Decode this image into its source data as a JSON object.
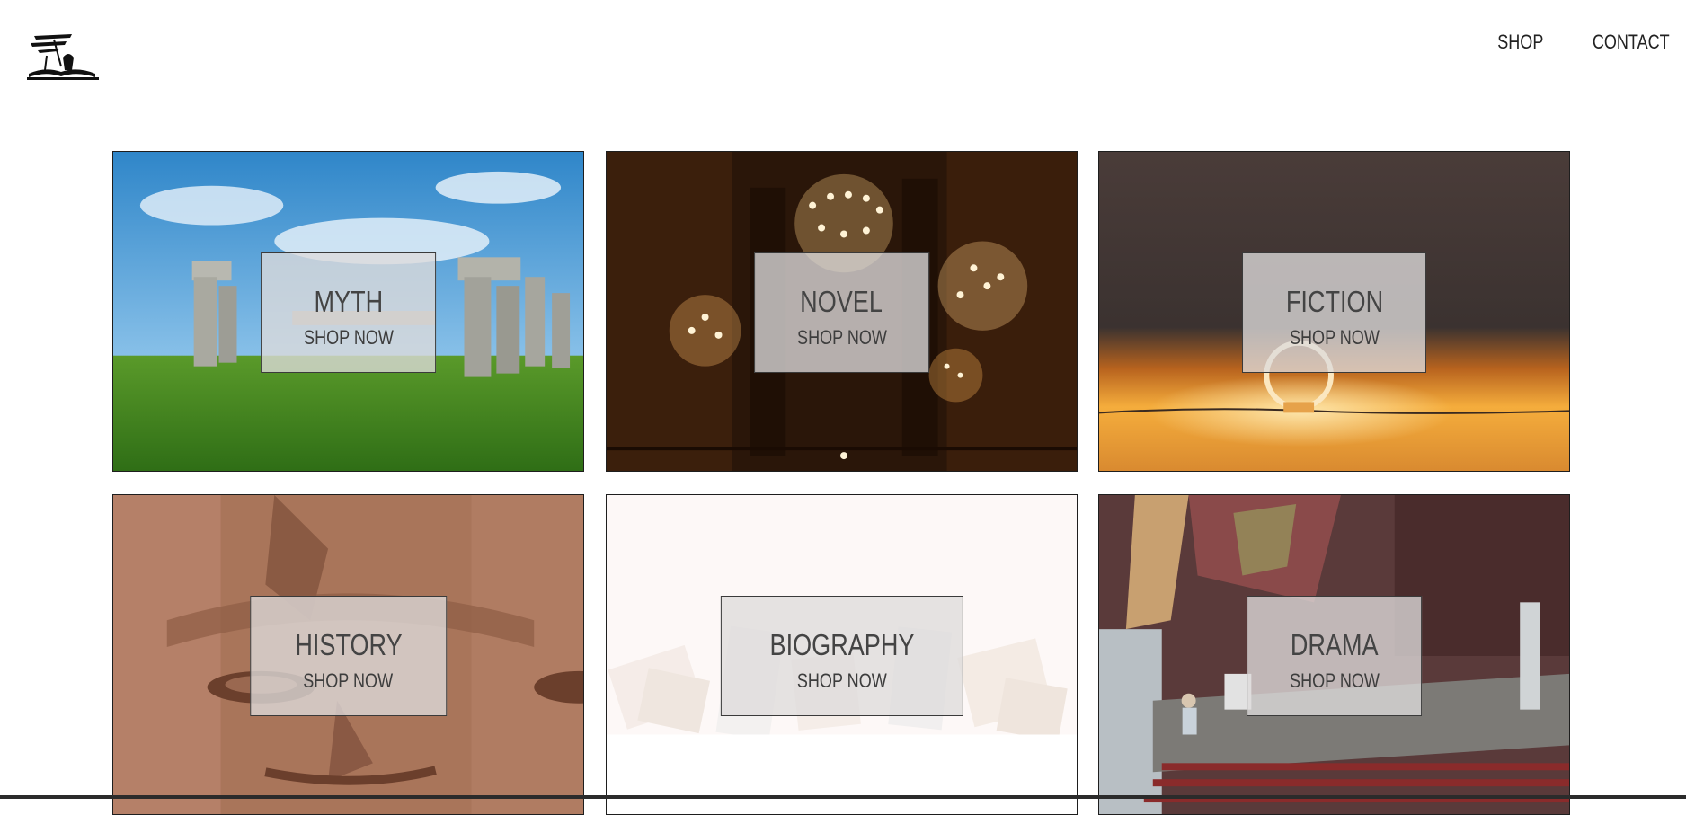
{
  "nav": {
    "items": [
      {
        "label": "SHOP"
      },
      {
        "label": "CONTACT"
      }
    ]
  },
  "tiles": [
    {
      "title": "MYTH",
      "cta": "SHOP NOW",
      "scene": "stonehenge"
    },
    {
      "title": "NOVEL",
      "cta": "SHOP NOW",
      "scene": "chandelier-hall"
    },
    {
      "title": "FICTION",
      "cta": "SHOP NOW",
      "scene": "glowing-ring-horizon"
    },
    {
      "title": "HISTORY",
      "cta": "SHOP NOW",
      "scene": "stone-pharaoh-face"
    },
    {
      "title": "BIOGRAPHY",
      "cta": "SHOP NOW",
      "scene": "scattered-open-books"
    },
    {
      "title": "DRAMA",
      "cta": "SHOP NOW",
      "scene": "theater-stage"
    }
  ],
  "icons": {
    "logo": "book-with-quills-logo-icon"
  }
}
